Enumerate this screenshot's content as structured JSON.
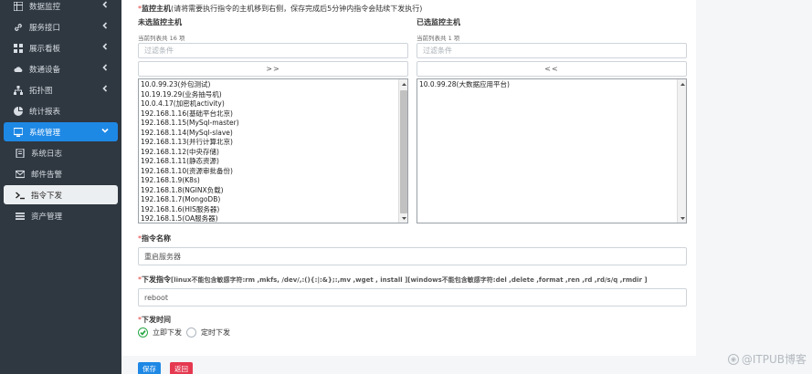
{
  "sidebar": {
    "items": [
      {
        "label": "数据监控",
        "icon": "grid-icon",
        "has_chevron": true
      },
      {
        "label": "服务接口",
        "icon": "link-icon",
        "has_chevron": true
      },
      {
        "label": "展示看板",
        "icon": "dashboard-icon",
        "has_chevron": true
      },
      {
        "label": "数通设备",
        "icon": "cloud-icon",
        "has_chevron": true
      },
      {
        "label": "拓扑图",
        "icon": "topology-icon",
        "has_chevron": true
      },
      {
        "label": "统计报表",
        "icon": "chart-icon",
        "has_chevron": false
      },
      {
        "label": "系统管理",
        "icon": "monitor-icon",
        "has_chevron": true,
        "active": true
      },
      {
        "label": "系统日志",
        "icon": "log-icon",
        "has_chevron": false
      },
      {
        "label": "邮件告警",
        "icon": "mail-icon",
        "has_chevron": false
      },
      {
        "label": "指令下发",
        "icon": "terminal-icon",
        "has_chevron": false,
        "selected": true
      },
      {
        "label": "资产管理",
        "icon": "list-icon",
        "has_chevron": false
      }
    ]
  },
  "form": {
    "monitor_host_label": "监控主机",
    "monitor_host_hint": "(请将需要执行指令的主机移到右侧，保存完成后5分钟内指令会陆续下发执行)",
    "unselected": {
      "title": "未选监控主机",
      "count_text": "当前列表共 16 项",
      "filter_placeholder": "过滤条件",
      "move_button": ">>",
      "options": [
        "10.0.99.23(外包测试)",
        "10.19.19.29(业务抽号机)",
        "10.0.4.17(加密机activity)",
        "192.168.1.16(基础平台北京)",
        "192.168.1.15(MySql-master)",
        "192.168.1.14(MySql-slave)",
        "192.168.1.13(并行计算北京)",
        "192.168.1.12(中央存储)",
        "192.168.1.11(静态资源)",
        "192.168.1.10(资源审批备份)",
        "192.168.1.9(K8s)",
        "192.168.1.8(NGINX负载)",
        "192.168.1.7(MongoDB)",
        "192.168.1.6(HIS服务器)",
        "192.168.1.5(OA服务器)"
      ]
    },
    "selected": {
      "title": "已选监控主机",
      "count_text": "当前列表共 1 项",
      "filter_placeholder": "过滤条件",
      "move_button": "<<",
      "options": [
        "10.0.99.28(大数据应用平台)"
      ]
    },
    "command_name_label": "指令名称",
    "command_name_value": "重启服务器",
    "command_label": "下发指令",
    "command_hint": "[linux不能包含敏感字符:rm ,mkfs, /dev/,:(){:|:&};:,mv ,wget , install ][windows不能包含敏感字符:del ,delete ,format ,ren ,rd ,rd/s/q ,rmdir ]",
    "command_value": "reboot",
    "send_time_label": "下发时间",
    "radio_now": "立即下发",
    "radio_scheduled": "定时下发",
    "save_button": "保存",
    "back_button": "返回"
  },
  "watermark": "@ITPUB博客",
  "colors": {
    "sidebar_bg": "#2f3740",
    "accent": "#1e88e5",
    "danger": "#e53950",
    "success": "#28a745"
  }
}
